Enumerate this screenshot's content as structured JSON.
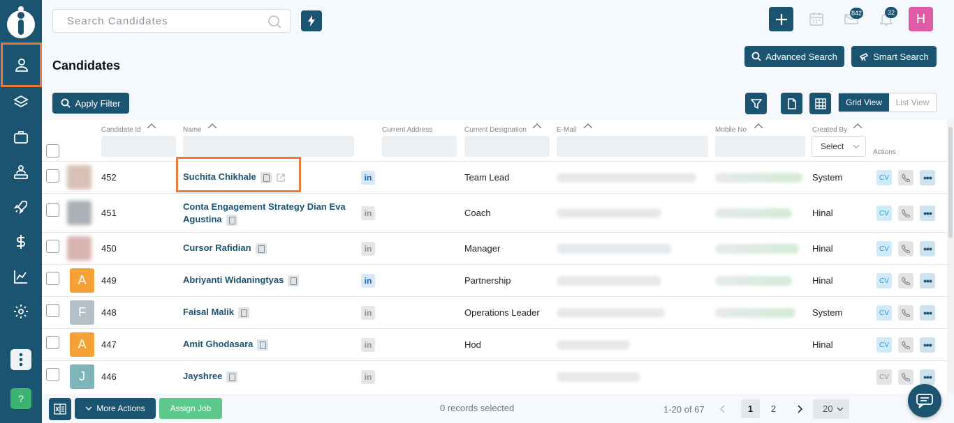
{
  "search": {
    "placeholder": "Search Candidates"
  },
  "header": {
    "mail_count": "842",
    "notif_count": "32",
    "user_initial": "H"
  },
  "page": {
    "title": "Candidates"
  },
  "buttons": {
    "advanced_search": "Advanced Search",
    "smart_search": "Smart Search",
    "apply_filter": "Apply Filter",
    "grid_view": "Grid View",
    "list_view": "List View"
  },
  "table": {
    "columns": {
      "candidate_id": "Candidate Id",
      "name": "Name",
      "current_address": "Current Address",
      "current_designation": "Current Designation",
      "email": "E-Mail",
      "mobile": "Mobile No",
      "created_by": "Created By",
      "actions": "Actions"
    },
    "created_by_select": "Select",
    "rows": [
      {
        "id": "452",
        "name": "Suchita Chikhale",
        "designation": "Team Lead",
        "created_by": "System",
        "cv": "CV",
        "initial": ""
      },
      {
        "id": "451",
        "name": "Conta Engagement Strategy Dian Eva Agustina",
        "designation": "Coach",
        "created_by": "Hinal",
        "cv": "CV",
        "initial": ""
      },
      {
        "id": "450",
        "name": "Cursor Rafidian",
        "designation": "Manager",
        "created_by": "Hinal",
        "cv": "CV",
        "initial": ""
      },
      {
        "id": "449",
        "name": "Abriyanti Widaningtyas",
        "designation": "Partnership",
        "created_by": "Hinal",
        "cv": "CV",
        "initial": "A"
      },
      {
        "id": "448",
        "name": "Faisal Malik",
        "designation": "Operations Leader",
        "created_by": "System",
        "cv": "CV",
        "initial": "F"
      },
      {
        "id": "447",
        "name": "Amit Ghodasara",
        "designation": "Hod",
        "created_by": "Hinal",
        "cv": "CV",
        "initial": "A"
      },
      {
        "id": "446",
        "name": "Jayshree",
        "designation": "",
        "created_by": "",
        "cv": "CV",
        "initial": "J"
      }
    ]
  },
  "footer": {
    "more_actions": "More Actions",
    "assign_job": "Assign Job",
    "records_selected": "0 records selected",
    "range": "1-20 of 67",
    "page1": "1",
    "page2": "2",
    "per_page": "20"
  },
  "colors": {
    "primary": "#1b5470",
    "highlight": "#e87b3a",
    "green": "#5cc98a",
    "avatar": "#e05ba6"
  },
  "help": "?"
}
